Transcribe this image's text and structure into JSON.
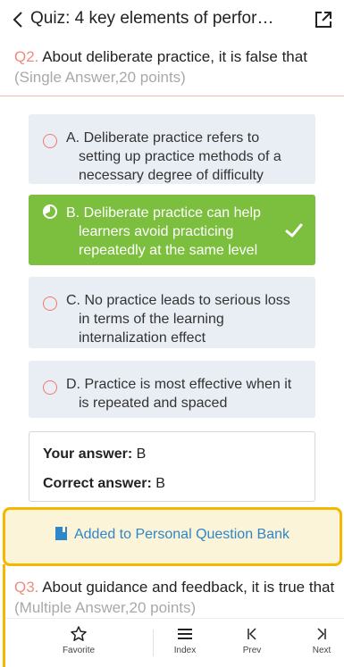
{
  "header": {
    "title": "Quiz: 4 key elements of perfor…"
  },
  "question2": {
    "number": "Q2.",
    "text": "About deliberate practice, it is false that",
    "meta": "(Single Answer,20 points)",
    "options": [
      {
        "label": "A. Deliberate practice refers to setting up practice methods of a necessary degree of difficulty",
        "state": "default"
      },
      {
        "label": "B. Deliberate practice can help learners avoid practicing repeatedly at the same level",
        "state": "correct"
      },
      {
        "label": "C. No practice leads to serious loss in terms of the learning internalization effect",
        "state": "default"
      },
      {
        "label": "D. Practice is most effective when it is repeated and spaced",
        "state": "default"
      }
    ],
    "your_answer_label": "Your answer:",
    "your_answer_value": "B",
    "correct_answer_label": "Correct answer:",
    "correct_answer_value": "B"
  },
  "bank_notice": {
    "text": "Added to Personal Question Bank",
    "icon": "bookmark-icon"
  },
  "question3": {
    "number": "Q3.",
    "text": "About guidance and feedback, it is true that",
    "meta": "(Multiple Answer,20 points)"
  },
  "bottom_nav": {
    "favorite": "Favorite",
    "index": "Index",
    "prev": "Prev",
    "next": "Next"
  },
  "colors": {
    "accent_red": "#f08a7c",
    "correct_green": "#7cbf3f",
    "highlight_border": "#f5b800",
    "link_blue": "#2f86c8"
  }
}
